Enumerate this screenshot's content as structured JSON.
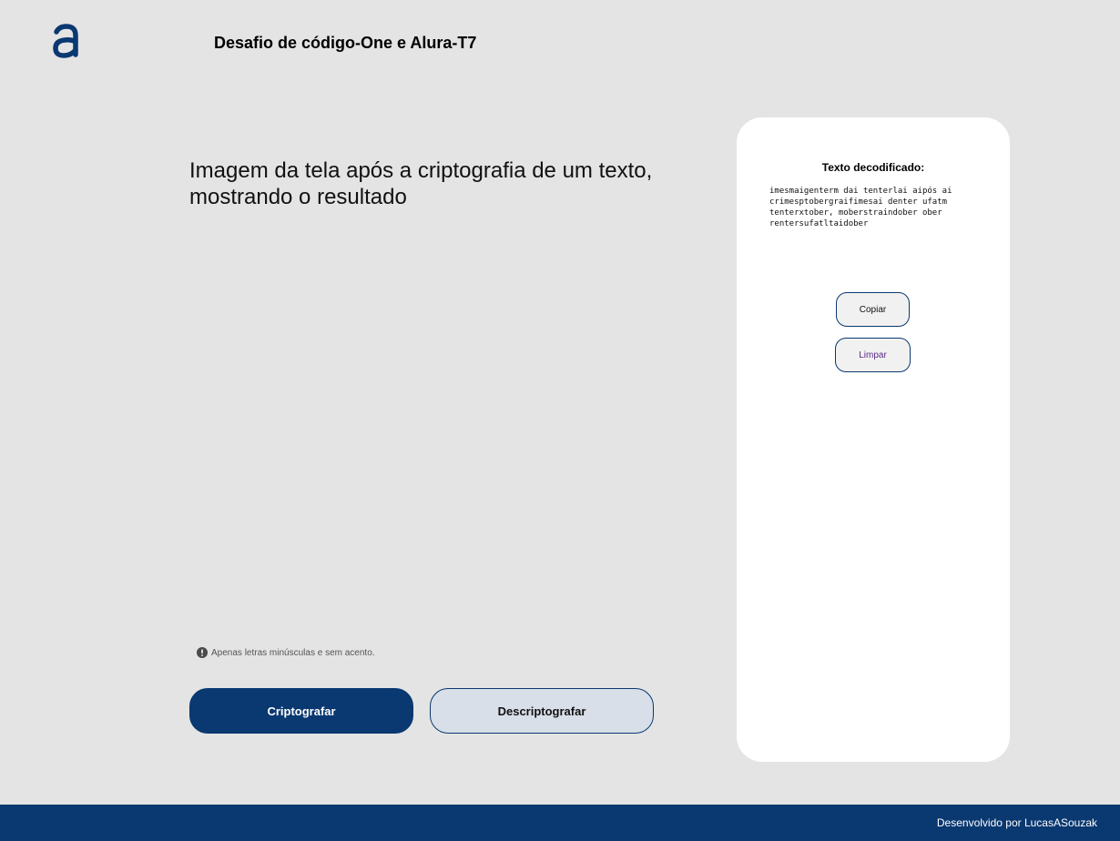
{
  "header": {
    "logo_icon": "alura-logo-icon",
    "title": "Desafio de código-One e Alura-T7"
  },
  "main": {
    "text": "Imagem da tela após a criptografia de um texto, mostrando o resultado",
    "hint_icon": "exclamation-circle-icon",
    "hint": "Apenas letras minúsculas e sem acento.",
    "encrypt_label": "Criptografar",
    "decrypt_label": "Descriptografar"
  },
  "result": {
    "title": "Texto decodificado:",
    "text": "imesmaigenterm dai tenterlai aipós ai crimesptobergraifimesai denter ufatm tenterxtober, moberstraindober ober rentersufatltaidober",
    "copy_label": "Copiar",
    "clear_label": "Limpar"
  },
  "footer": {
    "text": "Desenvolvido por LucasASouzak"
  },
  "colors": {
    "brand": "#0a3871",
    "background": "#e4e4e4",
    "panel": "#ffffff"
  }
}
